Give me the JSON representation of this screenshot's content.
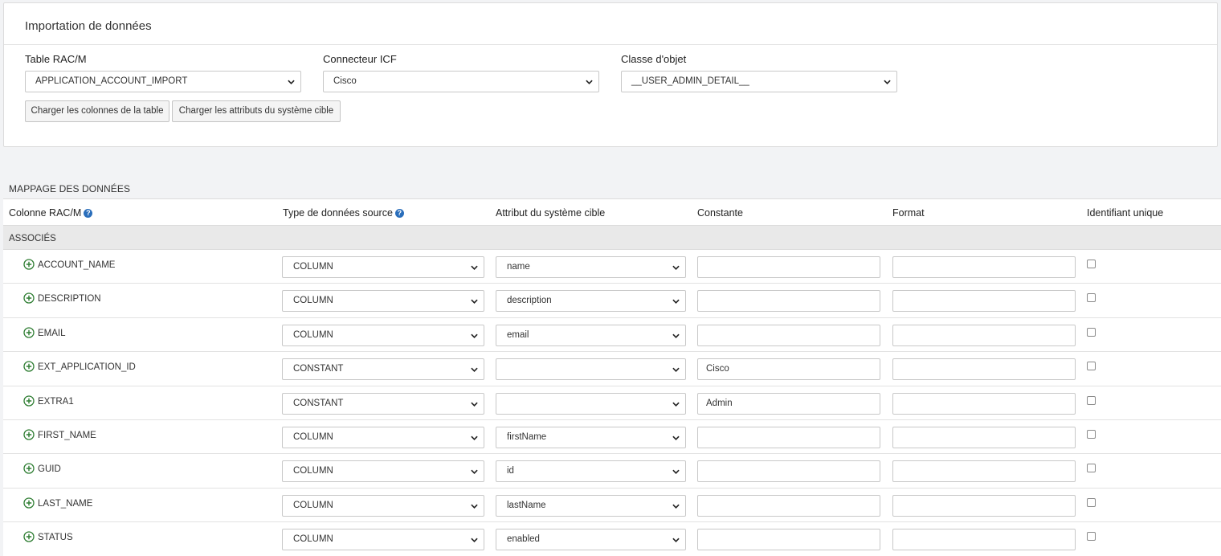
{
  "import": {
    "title": "Importation de données",
    "table_label": "Table RAC/M",
    "table_value": "APPLICATION_ACCOUNT_IMPORT",
    "connector_label": "Connecteur ICF",
    "connector_value": "Cisco",
    "class_label": "Classe d'objet",
    "class_value": "__USER_ADMIN_DETAIL__",
    "btn_load_columns": "Charger les colonnes de la table",
    "btn_load_attributes": "Charger les attributs du système cible"
  },
  "mapping": {
    "title": "MAPPAGE DES DONNÉES",
    "headers": {
      "column": "Colonne RAC/M",
      "source_type": "Type de données source",
      "target_attr": "Attribut du système cible",
      "constant": "Constante",
      "format": "Format",
      "unique_id": "Identifiant unique"
    },
    "help_glyph": "?",
    "group_label": "ASSOCIÉS",
    "rows": [
      {
        "column": "ACCOUNT_NAME",
        "source_type": "COLUMN",
        "target_attr": "name",
        "constant": "",
        "format": "",
        "unique": false
      },
      {
        "column": "DESCRIPTION",
        "source_type": "COLUMN",
        "target_attr": "description",
        "constant": "",
        "format": "",
        "unique": false
      },
      {
        "column": "EMAIL",
        "source_type": "COLUMN",
        "target_attr": "email",
        "constant": "",
        "format": "",
        "unique": false
      },
      {
        "column": "EXT_APPLICATION_ID",
        "source_type": "CONSTANT",
        "target_attr": "",
        "constant": "Cisco",
        "format": "",
        "unique": false
      },
      {
        "column": "EXTRA1",
        "source_type": "CONSTANT",
        "target_attr": "",
        "constant": "Admin",
        "format": "",
        "unique": false
      },
      {
        "column": "FIRST_NAME",
        "source_type": "COLUMN",
        "target_attr": "firstName",
        "constant": "",
        "format": "",
        "unique": false
      },
      {
        "column": "GUID",
        "source_type": "COLUMN",
        "target_attr": "id",
        "constant": "",
        "format": "",
        "unique": false
      },
      {
        "column": "LAST_NAME",
        "source_type": "COLUMN",
        "target_attr": "lastName",
        "constant": "",
        "format": "",
        "unique": false
      },
      {
        "column": "STATUS",
        "source_type": "COLUMN",
        "target_attr": "enabled",
        "constant": "",
        "format": "",
        "unique": false
      }
    ]
  },
  "icons": {
    "add": "plus-circle-icon",
    "help": "question-circle-icon",
    "dropdown": "chevron-down-icon"
  },
  "colors": {
    "accent_green": "#2e7d32",
    "help_blue": "#2a6ebb",
    "group_bg": "#e9e9e9"
  }
}
